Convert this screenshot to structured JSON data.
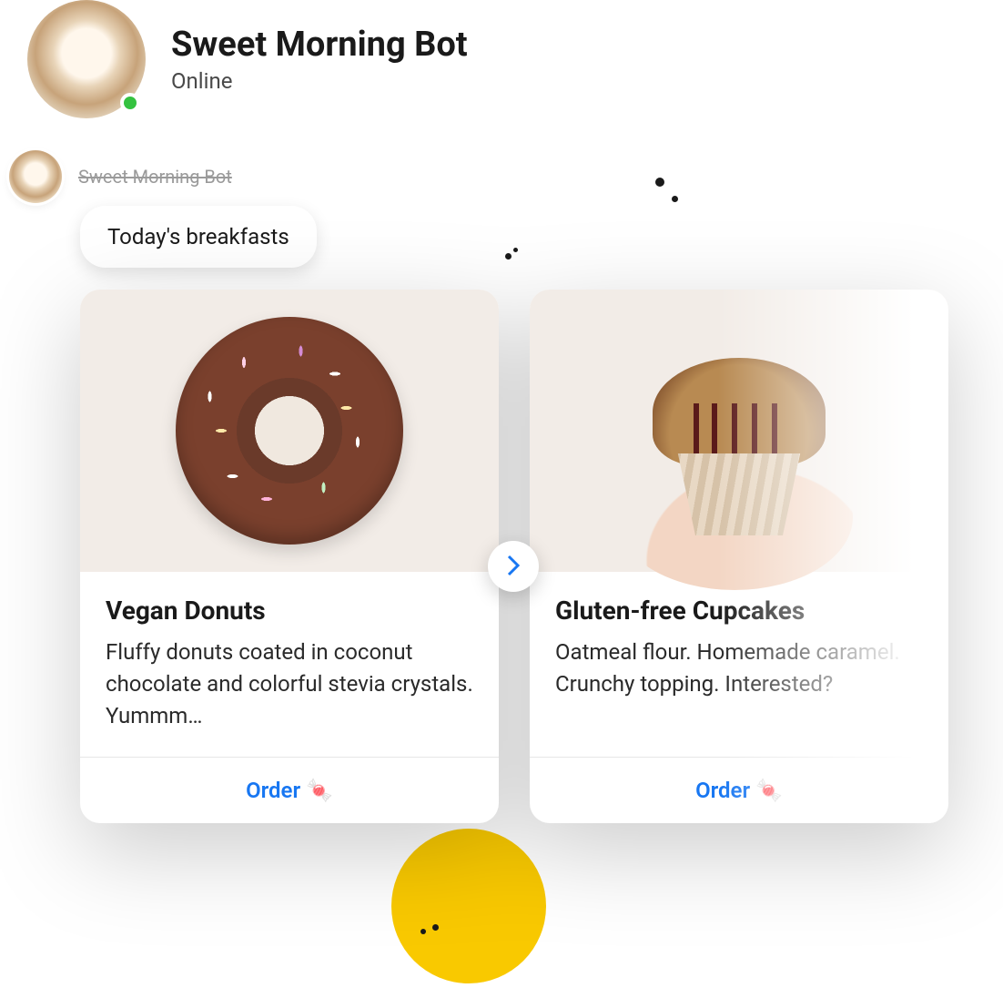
{
  "header": {
    "bot_name": "Sweet Morning Bot",
    "status_label": "Online"
  },
  "message": {
    "sender_name": "Sweet Morning Bot",
    "bubble_text": "Today's breakfasts"
  },
  "carousel": {
    "cards": [
      {
        "title": "Vegan Donuts",
        "description": "Fluffy donuts coated in coconut chocolate and colorful stevia crystals. Yummm…",
        "action_label": "Order 🍬"
      },
      {
        "title": "Gluten-free Cupcakes",
        "description": "Oatmeal flour. Homemade caramel. Crunchy topping. Interested?",
        "action_label": "Order 🍬"
      }
    ]
  },
  "colors": {
    "link_blue": "#1877f2",
    "online_green": "#34c240",
    "accent_yellow": "#f9c900"
  }
}
